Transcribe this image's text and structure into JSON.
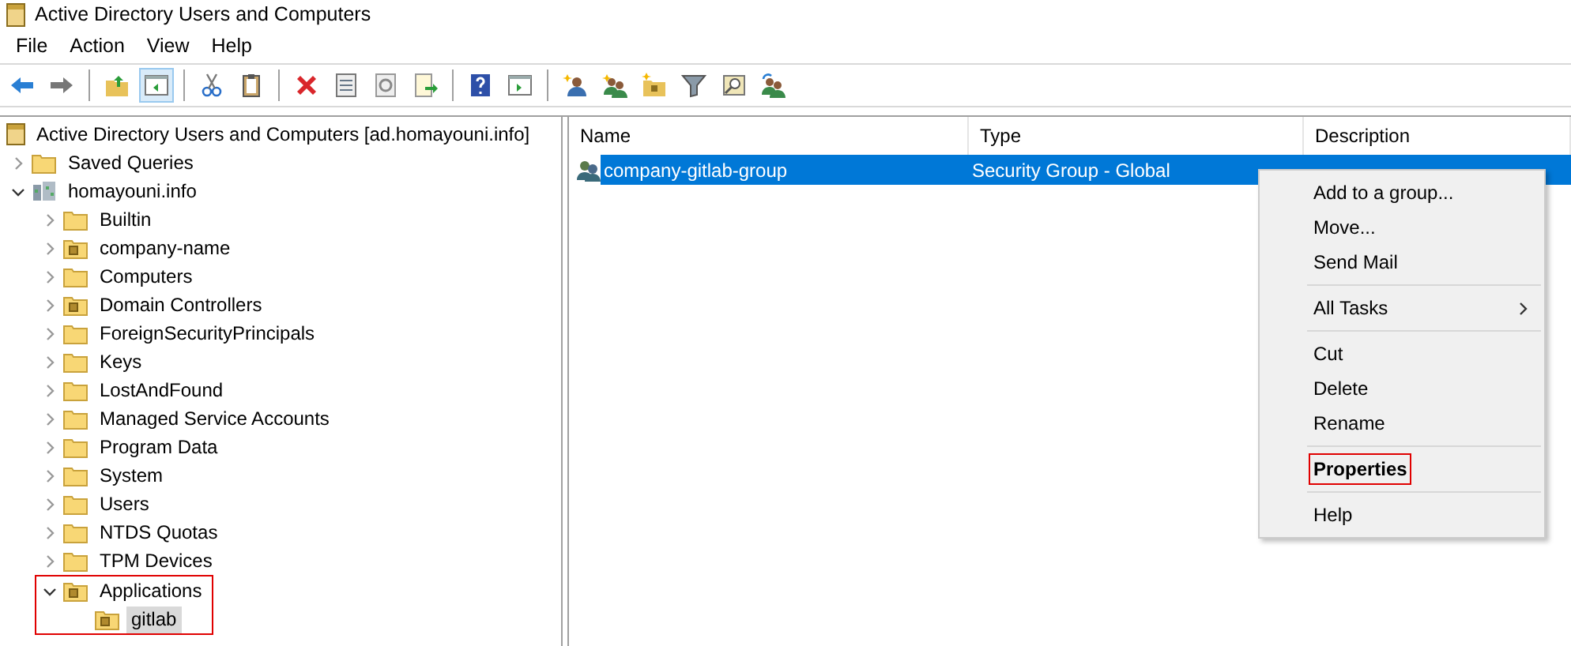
{
  "window": {
    "title": "Active Directory Users and Computers"
  },
  "menu": [
    "File",
    "Action",
    "View",
    "Help"
  ],
  "toolbar": [
    {
      "kind": "back"
    },
    {
      "kind": "forward"
    },
    {
      "kind": "sep"
    },
    {
      "kind": "up",
      "pressed": false
    },
    {
      "kind": "pane",
      "pressed": true
    },
    {
      "kind": "sep"
    },
    {
      "kind": "cut"
    },
    {
      "kind": "paste"
    },
    {
      "kind": "sep"
    },
    {
      "kind": "delete"
    },
    {
      "kind": "props"
    },
    {
      "kind": "refresh"
    },
    {
      "kind": "export"
    },
    {
      "kind": "sep"
    },
    {
      "kind": "help"
    },
    {
      "kind": "pane2"
    },
    {
      "kind": "sep"
    },
    {
      "kind": "user"
    },
    {
      "kind": "group"
    },
    {
      "kind": "ou"
    },
    {
      "kind": "filter"
    },
    {
      "kind": "find"
    },
    {
      "kind": "addgroup"
    }
  ],
  "tree": {
    "label": "Active Directory Users and Computers [ad.homayouni.info]",
    "kind": "root",
    "children": [
      {
        "label": "Saved Queries",
        "kind": "folder",
        "expanded": false
      },
      {
        "label": "homayouni.info",
        "kind": "domain",
        "expanded": true,
        "children": [
          {
            "label": "Builtin",
            "kind": "folder",
            "expanded": false
          },
          {
            "label": "company-name",
            "kind": "ou",
            "expanded": false
          },
          {
            "label": "Computers",
            "kind": "folder",
            "expanded": false
          },
          {
            "label": "Domain Controllers",
            "kind": "ou",
            "expanded": false
          },
          {
            "label": "ForeignSecurityPrincipals",
            "kind": "folder",
            "expanded": false
          },
          {
            "label": "Keys",
            "kind": "folder",
            "expanded": false
          },
          {
            "label": "LostAndFound",
            "kind": "folder",
            "expanded": false
          },
          {
            "label": "Managed Service Accounts",
            "kind": "folder",
            "expanded": false
          },
          {
            "label": "Program Data",
            "kind": "folder",
            "expanded": false
          },
          {
            "label": "System",
            "kind": "folder",
            "expanded": false
          },
          {
            "label": "Users",
            "kind": "folder",
            "expanded": false
          },
          {
            "label": "NTDS Quotas",
            "kind": "folder",
            "expanded": false
          },
          {
            "label": "TPM Devices",
            "kind": "folder",
            "expanded": false
          },
          {
            "label": "Applications",
            "kind": "ou",
            "expanded": true,
            "outlined": true,
            "children": [
              {
                "label": "gitlab",
                "kind": "ou",
                "selected": true
              }
            ]
          }
        ]
      }
    ]
  },
  "list": {
    "columns": [
      "Name",
      "Type",
      "Description"
    ],
    "rows": [
      {
        "name": "company-gitlab-group",
        "type": "Security Group - Global",
        "selected": true
      }
    ]
  },
  "context_menu": [
    {
      "kind": "item",
      "label": "Add to a group..."
    },
    {
      "kind": "item",
      "label": "Move..."
    },
    {
      "kind": "item",
      "label": "Send Mail"
    },
    {
      "kind": "sep"
    },
    {
      "kind": "submenu",
      "label": "All Tasks"
    },
    {
      "kind": "sep"
    },
    {
      "kind": "item",
      "label": "Cut"
    },
    {
      "kind": "item",
      "label": "Delete"
    },
    {
      "kind": "item",
      "label": "Rename"
    },
    {
      "kind": "sep"
    },
    {
      "kind": "item",
      "label": "Properties",
      "bold": true,
      "outlined": true
    },
    {
      "kind": "sep"
    },
    {
      "kind": "item",
      "label": "Help"
    }
  ]
}
